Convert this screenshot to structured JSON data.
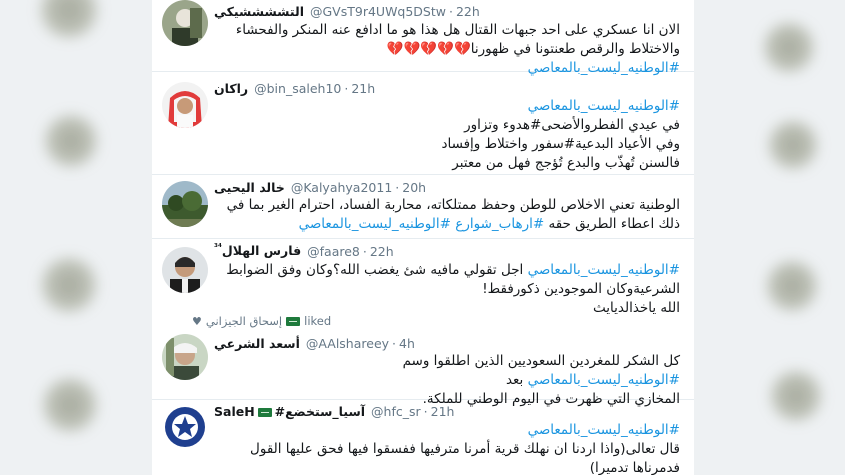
{
  "tweets": [
    {
      "name": "التششششيكي",
      "handle": "@GVsT9r4UWq5DStw",
      "time": "22h",
      "lines": [
        "الان انا عسكري على احد جبهات القتال هل هذا هو ما ادافع عنه المنكر والفحشاء",
        "والاختلاط والرقص طعنتونا في ظهورنا",
        "#الوطنيه_ليست_بالمعاصي"
      ],
      "hearts": "💔💔💔💔💔"
    },
    {
      "name": "راكان",
      "handle": "@bin_saleh10",
      "time": "21h",
      "lines": [
        "#الوطنيه_ليست_بالمعاصي",
        "في عيدي الفطروالأضحى#هدوء وتزاور",
        "وفي الأعياد البدعية#سفور واختلاط وإفساد",
        "فالسنن تُهذّب والبدع تُؤجج فهل من معتبر"
      ]
    },
    {
      "name": "خالد اليحيى",
      "handle": "@Kalyahya2011",
      "time": "20h",
      "lines": [
        "الوطنية تعني الاخلاص للوطن وحفظ ممتلكاته، محاربة الفساد، احترام الغير بما في",
        "ذلك اعطاء الطريق حقه",
        "#ارهاب_شوارع",
        "#الوطنيه_ليست_بالمعاصي"
      ]
    },
    {
      "name": "فارس الهلال",
      "name_suffix": "³⁴",
      "handle": "@faare8",
      "time": "22h",
      "lines": [
        "#الوطنيه_ليست_بالمعاصي",
        "اجل تقولي مافيه شئ يغضب الله؟وكان وفق الضوابط",
        "الشرعيةوكان الموجودين ذكورفقط!",
        "الله ياخذالديايث"
      ]
    },
    {
      "social_name": "إسحاق الجيزاني",
      "social_action": "liked",
      "name": "أسعد الشرعي",
      "handle": "@AAlshareey",
      "time": "4h",
      "lines": [
        "كل الشكر للمغردين السعوديين الذين اطلقوا وسم",
        "#الوطنيه_ليست_بالمعاصي",
        "بعد",
        "المخازي التي ظهرت في اليوم الوطني للملكة."
      ]
    },
    {
      "name": "آسيا_ستخضع#",
      "name_prefix": "SaleH",
      "handle": "@hfc_sr",
      "time": "21h",
      "lines": [
        "#الوطنيه_ليست_بالمعاصي",
        "قال تعالى(واذا اردنا ان نهلك قرية أمرنا مترفيها ففسقوا فيها فحق عليها القول",
        "فدمرناها تدميرا)"
      ]
    }
  ],
  "colors": {
    "hashtag": "#1b95e0",
    "text": "#14171a",
    "meta": "#657786",
    "background": "#e6ecf0"
  }
}
